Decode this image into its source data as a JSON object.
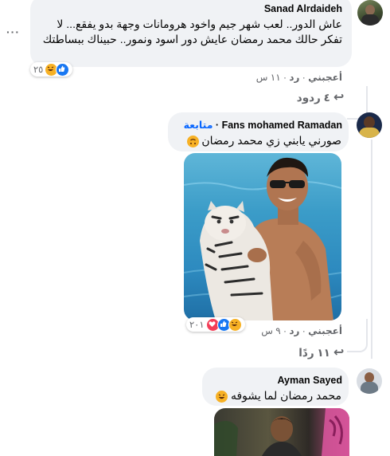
{
  "comments": [
    {
      "author": "Sanad Alrdaideh",
      "text": "عاش الدور.. لعب شهر جيم واخود هرومانات وجهة بدو يفقع... لا تفكر حالك محمد رمضان عايش دور اسود ونمور.. حبيناك ببساطتك",
      "reactions_count": "٢٥",
      "like_label": "أعجبني",
      "reply_label": "رد",
      "time": "١١ س",
      "replies_label": "٤ ردود",
      "more_label": "···"
    },
    {
      "author": "Fans mohamed Ramadan",
      "follow_label": "متابعة",
      "text": "صورني يابني زي محمد رمضان",
      "reactions_count": "٢٠١",
      "like_label": "أعجبني",
      "reply_label": "رد",
      "time": "٩ س",
      "replies_label": "١١ ردًا"
    },
    {
      "author": "Ayman Sayed",
      "text": "محمد رمضان لما يشوفه"
    }
  ],
  "colors": {
    "bubble": "#f0f2f5",
    "meta": "#65676b",
    "follow": "#0866ff",
    "like_blue": "#1877f2",
    "love_red": "#f33e58",
    "haha_yellow": "#f7b125"
  },
  "icons": [
    "reply-arrow-icon",
    "like-icon",
    "haha-icon",
    "love-icon",
    "more-options-icon"
  ]
}
